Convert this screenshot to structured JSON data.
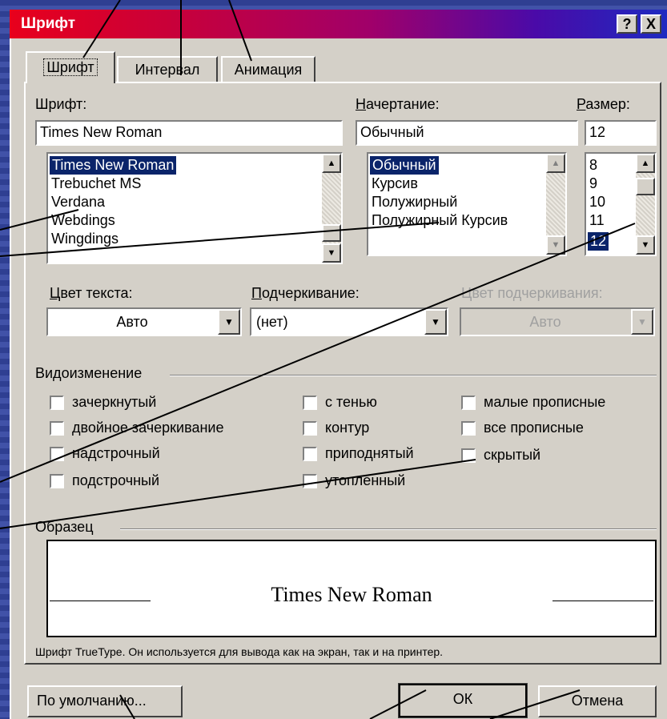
{
  "window": {
    "title": "Шрифт",
    "help_label": "?",
    "close_label": "X"
  },
  "tabs": [
    {
      "label": "Шрифт",
      "selected": true
    },
    {
      "label": "Интервал",
      "selected": false
    },
    {
      "label": "Анимация",
      "selected": false
    }
  ],
  "font": {
    "label": "Шрифт:",
    "value": "Times New Roman",
    "items": [
      "Times New Roman",
      "Trebuchet MS",
      "Verdana",
      "Webdings",
      "Wingdings"
    ],
    "selected": "Times New Roman"
  },
  "style": {
    "label": "Начертание:",
    "value": "Обычный",
    "items": [
      "Обычный",
      "Курсив",
      "Полужирный",
      "Полужирный Курсив"
    ],
    "selected": "Обычный"
  },
  "size": {
    "label": "Размер:",
    "value": "12",
    "items": [
      "8",
      "9",
      "10",
      "11",
      "12"
    ],
    "selected": "12"
  },
  "color": {
    "label": "Цвет текста:",
    "value": "Авто"
  },
  "underline": {
    "label": "Подчеркивание:",
    "value": "(нет)"
  },
  "underline_color": {
    "label": "Цвет подчеркивания:",
    "value": "Авто",
    "disabled": true
  },
  "effects": {
    "group_label": "Видоизменение",
    "col1": [
      "зачеркнутый",
      "двойное зачеркивание",
      "надстрочный",
      "подстрочный"
    ],
    "col2": [
      "с тенью",
      "контур",
      "приподнятый",
      "утопленный"
    ],
    "col3": [
      "малые прописные",
      "все прописные",
      "скрытый"
    ]
  },
  "preview": {
    "group_label": "Образец",
    "sample_text": "Times New Roman",
    "note": "Шрифт TrueType. Он используется для вывода как на экран, так и на принтер."
  },
  "buttons": {
    "default": "По умолчанию...",
    "ok": "ОК",
    "cancel": "Отмена"
  },
  "colors": {
    "selection": "#0a246a",
    "dialog": "#d4d0c8",
    "title_start": "#e8001c",
    "title_end": "#1e2ac0"
  }
}
